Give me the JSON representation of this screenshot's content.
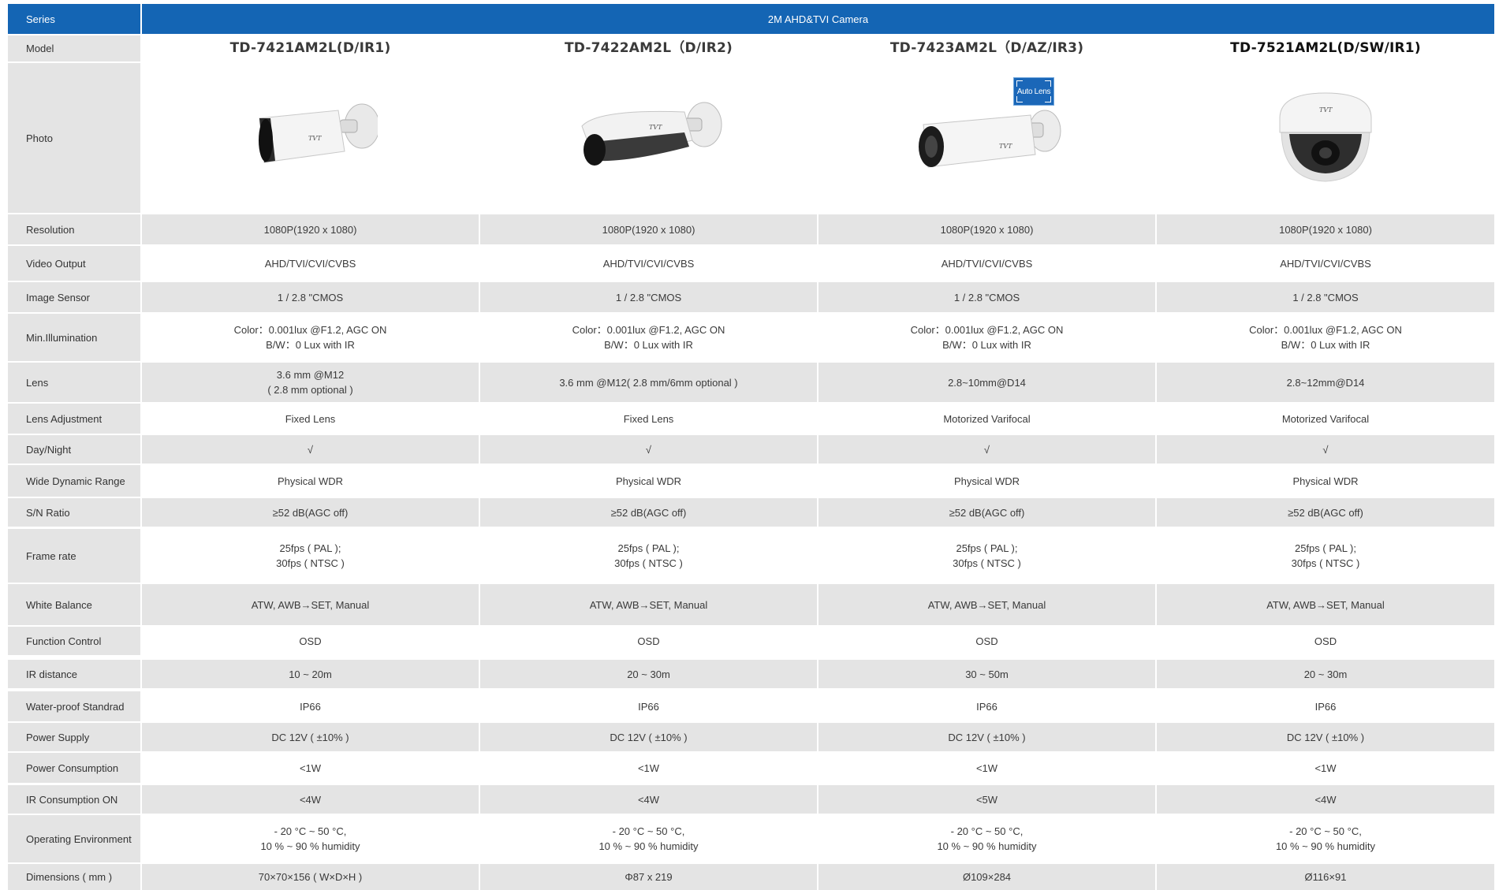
{
  "series": {
    "label": "Series",
    "value": "2M AHD&TVI  Camera"
  },
  "model_label": "Model",
  "models": [
    "TD-7421AM2L(D/IR1)",
    "TD-7422AM2L（D/IR2)",
    "TD-7423AM2L（D/AZ/IR3)",
    "TD-7521AM2L(D/SW/IR1)"
  ],
  "photo_label": "Photo",
  "photo_icons": [
    "bullet-camera-icon",
    "bullet-camera-icon",
    "bullet-camera-icon",
    "dome-camera-icon"
  ],
  "auto_lens_badge": "Auto Lens",
  "brand_mark": "TVT",
  "rows": [
    {
      "label": "Resolution",
      "values": [
        "1080P(1920 x 1080)",
        "1080P(1920 x 1080)",
        "1080P(1920 x 1080)",
        "1080P(1920 x 1080)"
      ]
    },
    {
      "label": "Video Output",
      "values": [
        "AHD/TVI/CVI/CVBS",
        "AHD/TVI/CVI/CVBS",
        "AHD/TVI/CVI/CVBS",
        "AHD/TVI/CVI/CVBS"
      ]
    },
    {
      "label": "Image Sensor",
      "values": [
        "1 / 2.8 \"CMOS",
        "1 / 2.8 \"CMOS",
        "1 / 2.8 \"CMOS",
        "1 / 2.8 \"CMOS"
      ]
    },
    {
      "label": "Min.Illumination",
      "values": [
        "Color：0.001lux @F1.2, AGC ON\nB/W：0 Lux with IR",
        "Color：0.001lux @F1.2, AGC ON\nB/W：0 Lux with IR",
        "Color：0.001lux @F1.2, AGC ON\nB/W：0 Lux with IR",
        "Color：0.001lux @F1.2, AGC ON\nB/W：0 Lux with IR"
      ]
    },
    {
      "label": "Lens",
      "values": [
        "3.6 mm @M12\n( 2.8 mm optional )",
        "3.6 mm @M12( 2.8 mm/6mm optional )",
        "2.8~10mm@D14",
        "2.8~12mm@D14"
      ]
    },
    {
      "label": "Lens Adjustment",
      "values": [
        "Fixed Lens",
        "Fixed Lens",
        "Motorized Varifocal",
        "Motorized Varifocal"
      ]
    },
    {
      "label": "Day/Night",
      "values": [
        "√",
        "√",
        "√",
        "√"
      ]
    },
    {
      "label": "Wide Dynamic Range",
      "values": [
        "Physical WDR",
        "Physical WDR",
        "Physical WDR",
        "Physical WDR"
      ]
    },
    {
      "label": "S/N Ratio",
      "values": [
        "≥52 dB(AGC off)",
        "≥52 dB(AGC off)",
        "≥52 dB(AGC off)",
        "≥52 dB(AGC off)"
      ]
    },
    {
      "label": "Frame rate",
      "values": [
        "25fps ( PAL );\n30fps ( NTSC )",
        "25fps ( PAL );\n30fps ( NTSC )",
        "25fps ( PAL );\n30fps ( NTSC )",
        "25fps ( PAL );\n30fps ( NTSC )"
      ]
    },
    {
      "label": "White Balance",
      "values": [
        "ATW, AWB→SET, Manual",
        "ATW, AWB→SET, Manual",
        "ATW, AWB→SET, Manual",
        "ATW, AWB→SET, Manual"
      ]
    },
    {
      "label": "Function Control",
      "values": [
        "OSD",
        "OSD",
        "OSD",
        "OSD"
      ]
    },
    {
      "label": "IR distance",
      "values": [
        "10 ~ 20m",
        "20 ~ 30m",
        "30 ~ 50m",
        "20 ~ 30m"
      ]
    },
    {
      "label": "Water-proof Standrad",
      "values": [
        "IP66",
        "IP66",
        "IP66",
        "IP66"
      ]
    },
    {
      "label": "Power Supply",
      "values": [
        "DC 12V ( ±10% )",
        "DC 12V ( ±10% )",
        "DC 12V ( ±10% )",
        "DC 12V ( ±10% )"
      ]
    },
    {
      "label": "Power Consumption",
      "values": [
        "<1W",
        "<1W",
        "<1W",
        "<1W"
      ]
    },
    {
      "label": "IR Consumption ON",
      "values": [
        "<4W",
        "<4W",
        "<5W",
        "<4W"
      ]
    },
    {
      "label": "Operating Environment",
      "values": [
        "- 20 °C ~ 50 °C,\n10 % ~ 90 % humidity",
        "- 20 °C ~ 50 °C,\n10 % ~ 90 % humidity",
        "- 20 °C ~ 50 °C,\n10 % ~ 90 % humidity",
        "- 20 °C ~ 50 °C,\n10 % ~ 90 % humidity"
      ]
    },
    {
      "label": "Dimensions ( mm )",
      "values": [
        "70×70×156 ( W×D×H )",
        "Φ87 x 219",
        "Ø109×284",
        "Ø116×91"
      ]
    }
  ],
  "colors": {
    "header_blue": "#1465b4",
    "row_gray": "#e4e4e4",
    "text": "#3a3a3a"
  }
}
